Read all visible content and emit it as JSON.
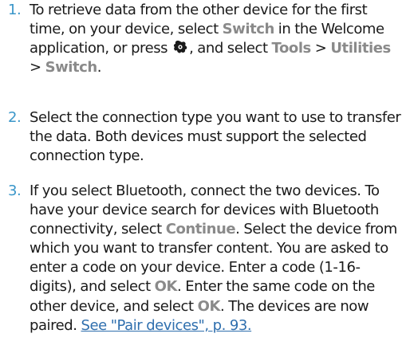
{
  "steps": [
    {
      "number": "1.",
      "parts": {
        "a": "To retrieve data from the other device for the first time, on your device, select ",
        "switch1": "Switch",
        "b": " in the Welcome application, or press ",
        "icon": "menu-key-icon",
        "c": ", and select ",
        "tools": "Tools",
        "sep1": " > ",
        "utilities": "Utilities",
        "sep2": " > ",
        "switch2": "Switch",
        "d": "."
      }
    },
    {
      "number": "2.",
      "text": "Select the connection type you want to use to transfer the data. Both devices must support the selected connection type."
    },
    {
      "number": "3.",
      "parts": {
        "a": "If you select Bluetooth, connect the two devices. To have your device search for devices with Bluetooth connectivity, select ",
        "continue": "Continue",
        "b": ". Select the device from which you want to transfer content. You are asked to enter a code on your device. Enter a code (1-16-digits), and select ",
        "ok1": "OK",
        "c": ". Enter the same code on the other device, and select ",
        "ok2": "OK",
        "d": ". The devices are now paired. ",
        "link": "See \"Pair devices\", p. 93."
      }
    }
  ],
  "colors": {
    "number": "#3a96c9",
    "ui_term": "#8a8a8a",
    "link": "#2f6fae",
    "body_text": "#1a1a1a"
  }
}
